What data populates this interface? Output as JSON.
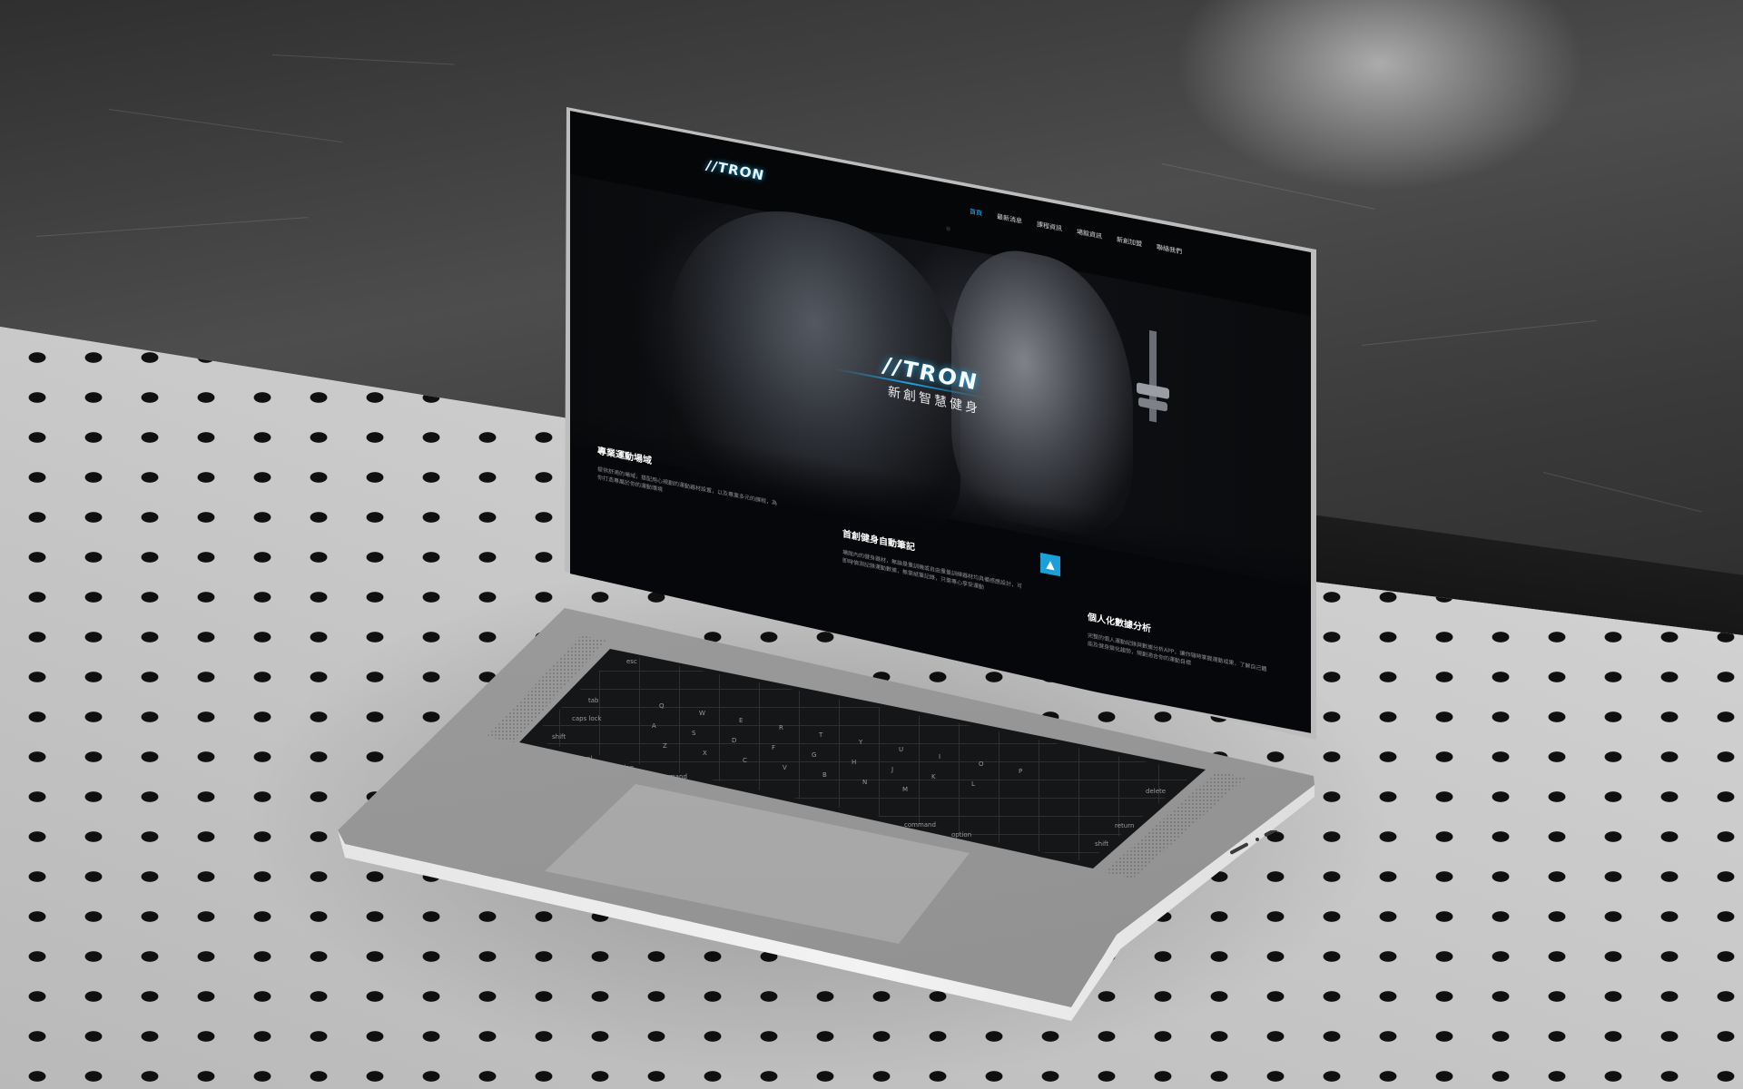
{
  "site": {
    "nav_logo": "//TRON",
    "nav": [
      {
        "label": "首頁",
        "active": true
      },
      {
        "label": "最新消息",
        "active": false
      },
      {
        "label": "課程資訊",
        "active": false
      },
      {
        "label": "場館資訊",
        "active": false
      },
      {
        "label": "新創加盟",
        "active": false
      },
      {
        "label": "聯絡我們",
        "active": false
      }
    ],
    "hero": {
      "logo": "//TRON",
      "slogan": "新創智慧健身"
    },
    "features": [
      {
        "title": "專業運動場域",
        "text": "提供舒適的場域，搭配用心規劃的運動器材設置，以及專業多元的課程，為你打造專屬於你的運動環境"
      },
      {
        "title": "首創健身自動筆記",
        "text": "場館內的健身器材，無論是重訓機或自由重量訓練器材均具備感應設計，可即時偵測記錄運動數據，無需紙筆記錄，只需專心享受運動"
      },
      {
        "title": "個人化數據分析",
        "text": "完整的個人運動紀錄與數據分析APP，讓你隨時掌握運動成果，了解自己體能及健身變化趨勢，規劃適合你的運動目標"
      }
    ],
    "feature_icon": "flame-icon"
  },
  "keyboard": {
    "labels": [
      "esc",
      "tab",
      "caps lock",
      "shift",
      "control",
      "option",
      "command",
      "delete",
      "return",
      "shift",
      "command",
      "option",
      "Q",
      "W",
      "E",
      "R",
      "T",
      "Y",
      "U",
      "I",
      "O",
      "P",
      "A",
      "S",
      "D",
      "F",
      "G",
      "H",
      "J",
      "K",
      "L",
      "Z",
      "X",
      "C",
      "V",
      "B",
      "N",
      "M"
    ]
  },
  "colors": {
    "accent": "#1da7e8",
    "screen_bg": "#050607",
    "laptop_body": "#9c9c9c"
  }
}
